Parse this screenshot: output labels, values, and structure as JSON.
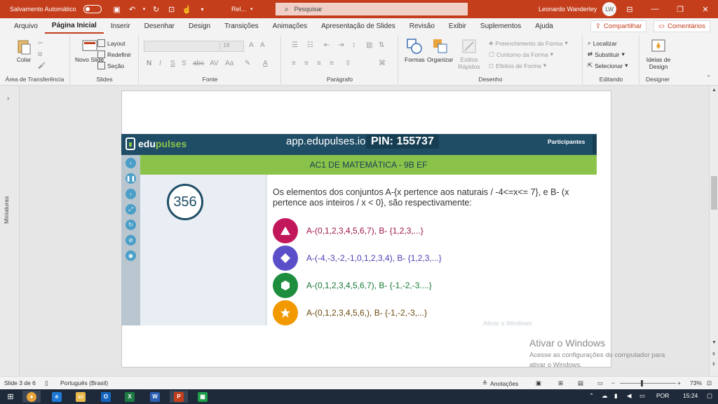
{
  "titlebar": {
    "autosave_label": "Salvamento Automático",
    "doc_name": "Rel...",
    "search_placeholder": "Pesquisar",
    "user_name": "Leonardo Wanderley",
    "user_initials": "LW"
  },
  "tabs": [
    "Arquivo",
    "Página Inicial",
    "Inserir",
    "Desenhar",
    "Design",
    "Transições",
    "Animações",
    "Apresentação de Slides",
    "Revisão",
    "Exibir",
    "Suplementos",
    "Ajuda"
  ],
  "share_label": "Compartilhar",
  "comments_label": "Comentários",
  "ribbon": {
    "paste_label": "Colar",
    "clipboard_group": "Área de Transferência",
    "new_slide_label": "Novo Slide",
    "layout_label": "Layout",
    "reset_label": "Redefinir",
    "section_label": "Seção",
    "slides_group": "Slides",
    "font_size": "18",
    "font_group": "Fonte",
    "paragraph_group": "Parágrafo",
    "shapes_label": "Formas",
    "arrange_label": "Organizar",
    "quick_styles_label": "Estilos Rápidos",
    "shape_fill_label": "Preenchimento da Forma",
    "shape_outline_label": "Contorno da Forma",
    "shape_effects_label": "Efeitos de Forma",
    "drawing_group": "Desenho",
    "find_label": "Localizar",
    "replace_label": "Substituir",
    "select_label": "Selecionar",
    "editing_group": "Editando",
    "design_ideas_label": "Ideias de Design",
    "designer_group": "Designer"
  },
  "thumbnails_label": "Miniaturas",
  "slide": {
    "app_url": "app.edupulses.io",
    "pin": "PIN: 155737",
    "participants": "Participantes",
    "logo_edu": "edu",
    "logo_pulses": "pulses",
    "quiz_title": "AC1 DE MATEMÁTICA - 9B EF",
    "counter": "356",
    "question": "Os elementos dos conjuntos A-{x pertence aos naturais / -4<=x<= 7}, e B- (x pertence aos inteiros / x < 0}, são respectivamente:",
    "options": [
      {
        "text": "A-(0,1,2,3,4,5,6,7), B- {1,2,3,...}",
        "color": "#c2185b",
        "shape": "triangle-icon"
      },
      {
        "text": "A-(-4,-3,-2,-1,0,1,2,3,4), B- {1,2,3,...}",
        "color": "#5b4fc9",
        "shape": "diamond-icon"
      },
      {
        "text": "A-(0,1,2,3,4,5,6,7), B- {-1,-2,-3....}",
        "color": "#1e8e3e",
        "shape": "hexagon-icon"
      },
      {
        "text": "A-(0,1,2,3,4,5,6,), B- {-1,-2,-3,...}",
        "color": "#f29900",
        "shape": "star-icon"
      }
    ],
    "watermark_small": "Ativar o Windows"
  },
  "activation": {
    "title": "Ativar o Windows",
    "line1": "Acesse as configurações do computador para",
    "line2": "ativar o Windows."
  },
  "status": {
    "slide_info": "Slide 3 de 6",
    "language": "Português (Brasil)",
    "notes_label": "Anotações",
    "zoom": "73%"
  },
  "taskbar": {
    "lang": "POR",
    "time": "15:24"
  },
  "colors": {
    "accent": "#c43e1c",
    "edu_dark": "#1f4d66",
    "edu_green": "#8bc34a"
  }
}
